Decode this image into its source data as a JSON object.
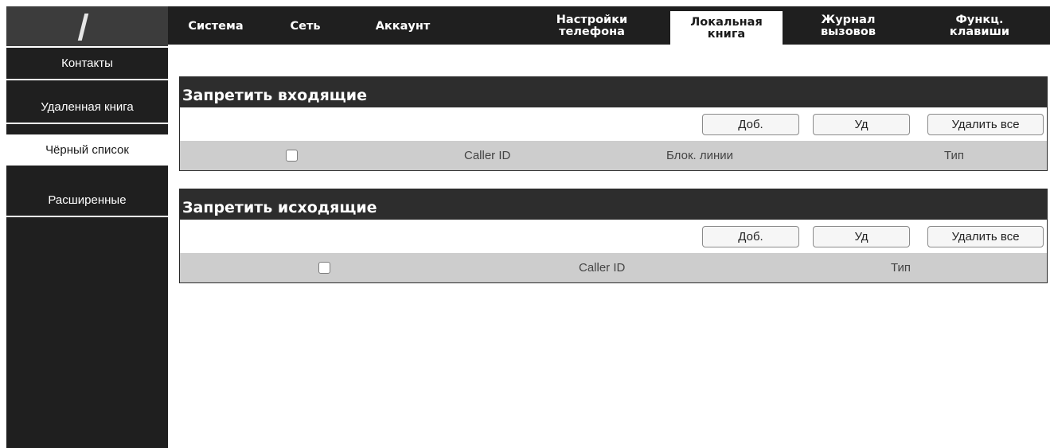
{
  "header": {
    "tabs": [
      {
        "label": "Система"
      },
      {
        "label": "Сеть"
      },
      {
        "label": "Аккаунт"
      },
      {
        "label": "Настройки\nтелефона"
      },
      {
        "label": "Локальная\nкнига"
      },
      {
        "label": "Журнал\nвызовов"
      },
      {
        "label": "Функц.\nклавиши"
      }
    ],
    "active_tab": "Локальная\nкнига"
  },
  "sidebar": {
    "items": [
      {
        "label": "Контакты"
      },
      {
        "label": "Удаленная книга"
      },
      {
        "label": "Чёрный список"
      },
      {
        "label": "Расширенные"
      }
    ],
    "active_item": "Чёрный список"
  },
  "incoming": {
    "title": "Запретить входящие",
    "add_label": "Доб.",
    "delete_label": "Уд",
    "delete_all_label": "Удалить все",
    "columns": [
      "Caller ID",
      "Блок. линии",
      "Тип"
    ]
  },
  "outgoing": {
    "title": "Запретить исходящие",
    "add_label": "Доб.",
    "delete_label": "Уд",
    "delete_all_label": "Удалить все",
    "columns": [
      "Caller ID",
      "Тип"
    ]
  }
}
